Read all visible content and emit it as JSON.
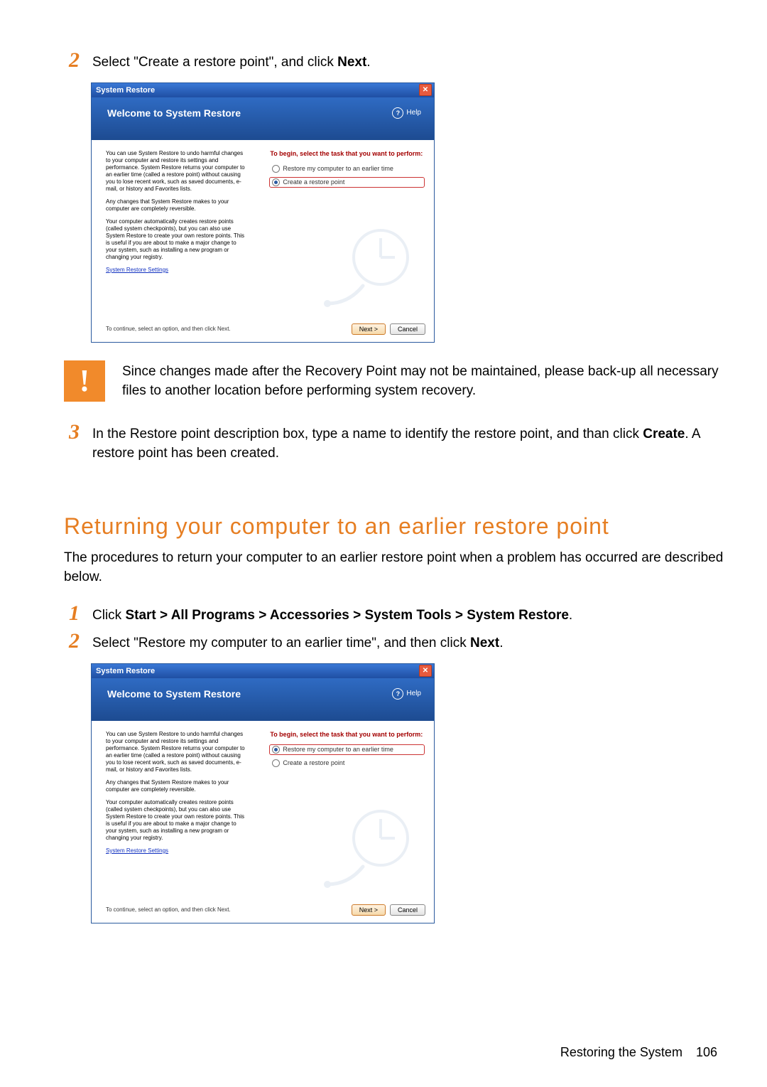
{
  "step2": {
    "num": "2",
    "text_a": "Select \"Create a restore point\", and click ",
    "text_b": "Next",
    "text_c": "."
  },
  "dialog": {
    "window_title": "System Restore",
    "header_title": "Welcome to System Restore",
    "help_label": "Help",
    "left_p1": "You can use System Restore to undo harmful changes to your computer and restore its settings and performance. System Restore returns your computer to an earlier time (called a restore point) without causing you to lose recent work, such as saved documents, e-mail, or history and Favorites lists.",
    "left_p2": "Any changes that System Restore makes to your computer are completely reversible.",
    "left_p3": "Your computer automatically creates restore points (called system checkpoints), but you can also use System Restore to create your own restore points. This is useful if you are about to make a major change to your system, such as installing a new program or changing your registry.",
    "left_link": "System Restore Settings",
    "right_title": "To begin, select the task that you want to perform:",
    "opt_restore": "Restore my computer to an earlier time",
    "opt_create": "Create a restore point",
    "footer_hint": "To continue, select an option, and then click Next.",
    "btn_next": "Next >",
    "btn_cancel": "Cancel"
  },
  "warn": {
    "mark": "!",
    "text": "Since changes made after the Recovery Point may not be maintained, please back-up all necessary files to another location before performing system recovery."
  },
  "step3": {
    "num": "3",
    "text_a": "In the Restore point description box, type a name to identify the restore point, and than click ",
    "text_b": "Create",
    "text_c": ". A restore point has been created."
  },
  "heading2": "Returning your computer to an earlier restore point",
  "heading2_sub": "The procedures to return your computer to an earlier restore point when a problem has occurred are described below.",
  "s2_step1": {
    "num": "1",
    "prefix": "Click ",
    "bold": "Start > All Programs > Accessories > System Tools > System Restore",
    "suffix": "."
  },
  "s2_step2": {
    "num": "2",
    "text_a": "Select \"Restore my computer to an earlier time\", and then click ",
    "text_b": "Next",
    "text_c": "."
  },
  "footer": {
    "label": "Restoring the System",
    "page": "106"
  }
}
